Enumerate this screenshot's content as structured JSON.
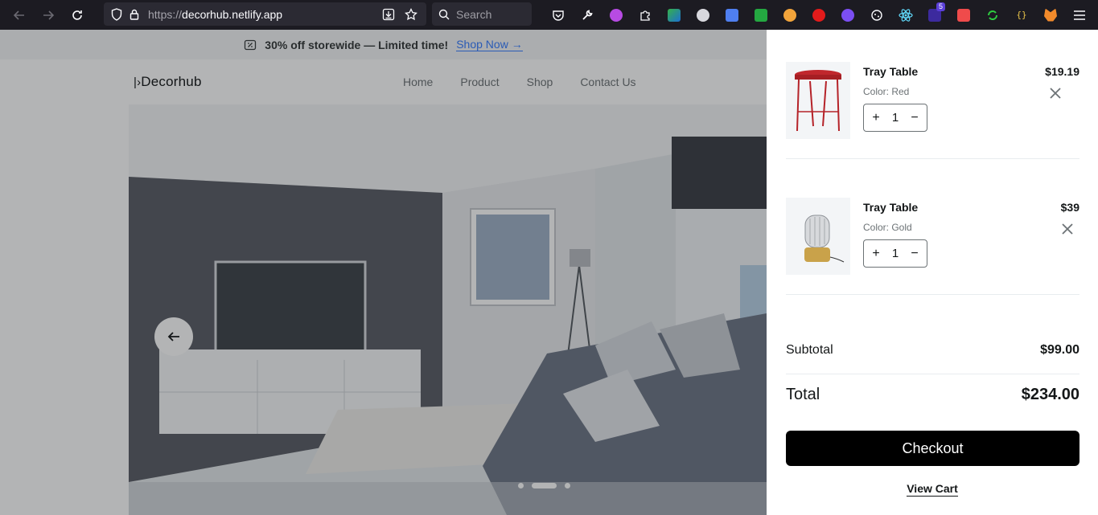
{
  "browser": {
    "url_scheme": "https://",
    "url_host": "decorhub.netlify.app",
    "search_placeholder": "Search",
    "extensions_badge": "5"
  },
  "promo": {
    "text": "30% off storewide — Limited time!",
    "link": "Shop Now"
  },
  "header": {
    "logo": "Decorhub",
    "nav": [
      "Home",
      "Product",
      "Shop",
      "Contact Us"
    ]
  },
  "hero": {
    "slide_count": 3,
    "active_slide": 2
  },
  "cart": {
    "items": [
      {
        "name": "Tray Table",
        "color": "Color: Red",
        "quantity": "1",
        "price": "$19.19"
      },
      {
        "name": "Tray Table",
        "color": "Color: Gold",
        "quantity": "1",
        "price": "$39"
      }
    ],
    "subtotal_label": "Subtotal",
    "subtotal_value": "$99.00",
    "total_label": "Total",
    "total_value": "$234.00",
    "checkout_label": "Checkout",
    "view_cart_label": "View Cart"
  },
  "colors": {
    "accent": "#377dff",
    "text_dark": "#141718",
    "text_muted": "#6c7275"
  }
}
